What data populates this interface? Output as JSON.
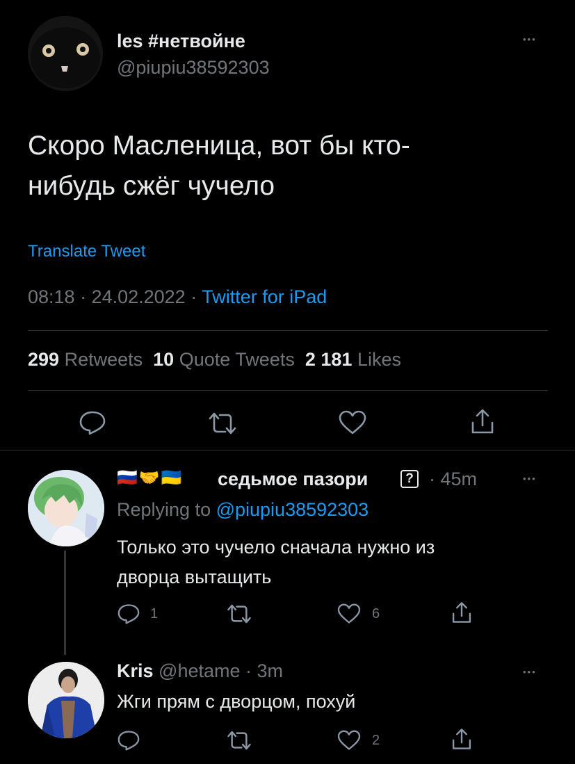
{
  "main_tweet": {
    "display_name": "les #нетвойне",
    "handle": "@piupiu38592303",
    "text_line1": "Скоро Масленица, вот бы кто-",
    "text_line2": "нибудь сжёг чучело",
    "translate_label": "Translate Tweet",
    "timestamp": "08:18 · 24.02.2022 · ",
    "source": "Twitter for iPad",
    "stats": {
      "retweets_count": "299",
      "retweets_label": "Retweets",
      "quotes_count": "10",
      "quotes_label": "Quote Tweets",
      "likes_count": "2 181",
      "likes_label": "Likes"
    },
    "more_glyph": "•••"
  },
  "replies": [
    {
      "flags": "🇷🇺🤝🇺🇦",
      "display_name": "седьмое пазори",
      "badge": "?",
      "time": "· 45m",
      "replying_prefix": "Replying to ",
      "replying_handle": "@piupiu38592303",
      "text_line1": "Только это чучело сначала нужно из",
      "text_line2": "дворца вытащить",
      "reply_count": "1",
      "like_count": "6",
      "more_glyph": "•••"
    },
    {
      "display_name": "Kris",
      "handle": "@hetame",
      "time": "· 3m",
      "text_line1": "Жги прям с дворцом, похуй",
      "like_count": "2",
      "more_glyph": "•••"
    }
  ],
  "colors": {
    "background": "#000000",
    "text": "#e7e9ea",
    "muted": "#71767b",
    "accent": "#1d9bf0",
    "divider": "#2f3336"
  },
  "icons": [
    "reply-icon",
    "retweet-icon",
    "like-icon",
    "share-icon",
    "more-icon",
    "cat-avatar",
    "anime-avatar",
    "kris-avatar"
  ]
}
